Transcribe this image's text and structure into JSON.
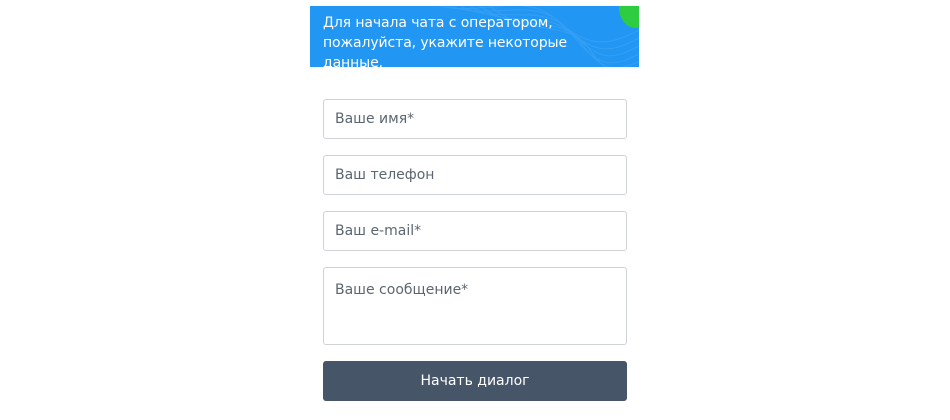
{
  "banner": {
    "line1": "Для начала чата с оператором,",
    "line2": "пожалуйста, укажите некоторые данные."
  },
  "form": {
    "name_placeholder": "Ваше имя*",
    "phone_placeholder": "Ваш телефон",
    "email_placeholder": "Ваш e-mail*",
    "message_placeholder": "Ваше сообщение*",
    "submit_label": "Начать диалог"
  },
  "colors": {
    "banner_bg": "#2196f3",
    "banner_accent": "#2ecc40",
    "button_bg": "#465568",
    "field_border": "#cfd3d8"
  }
}
